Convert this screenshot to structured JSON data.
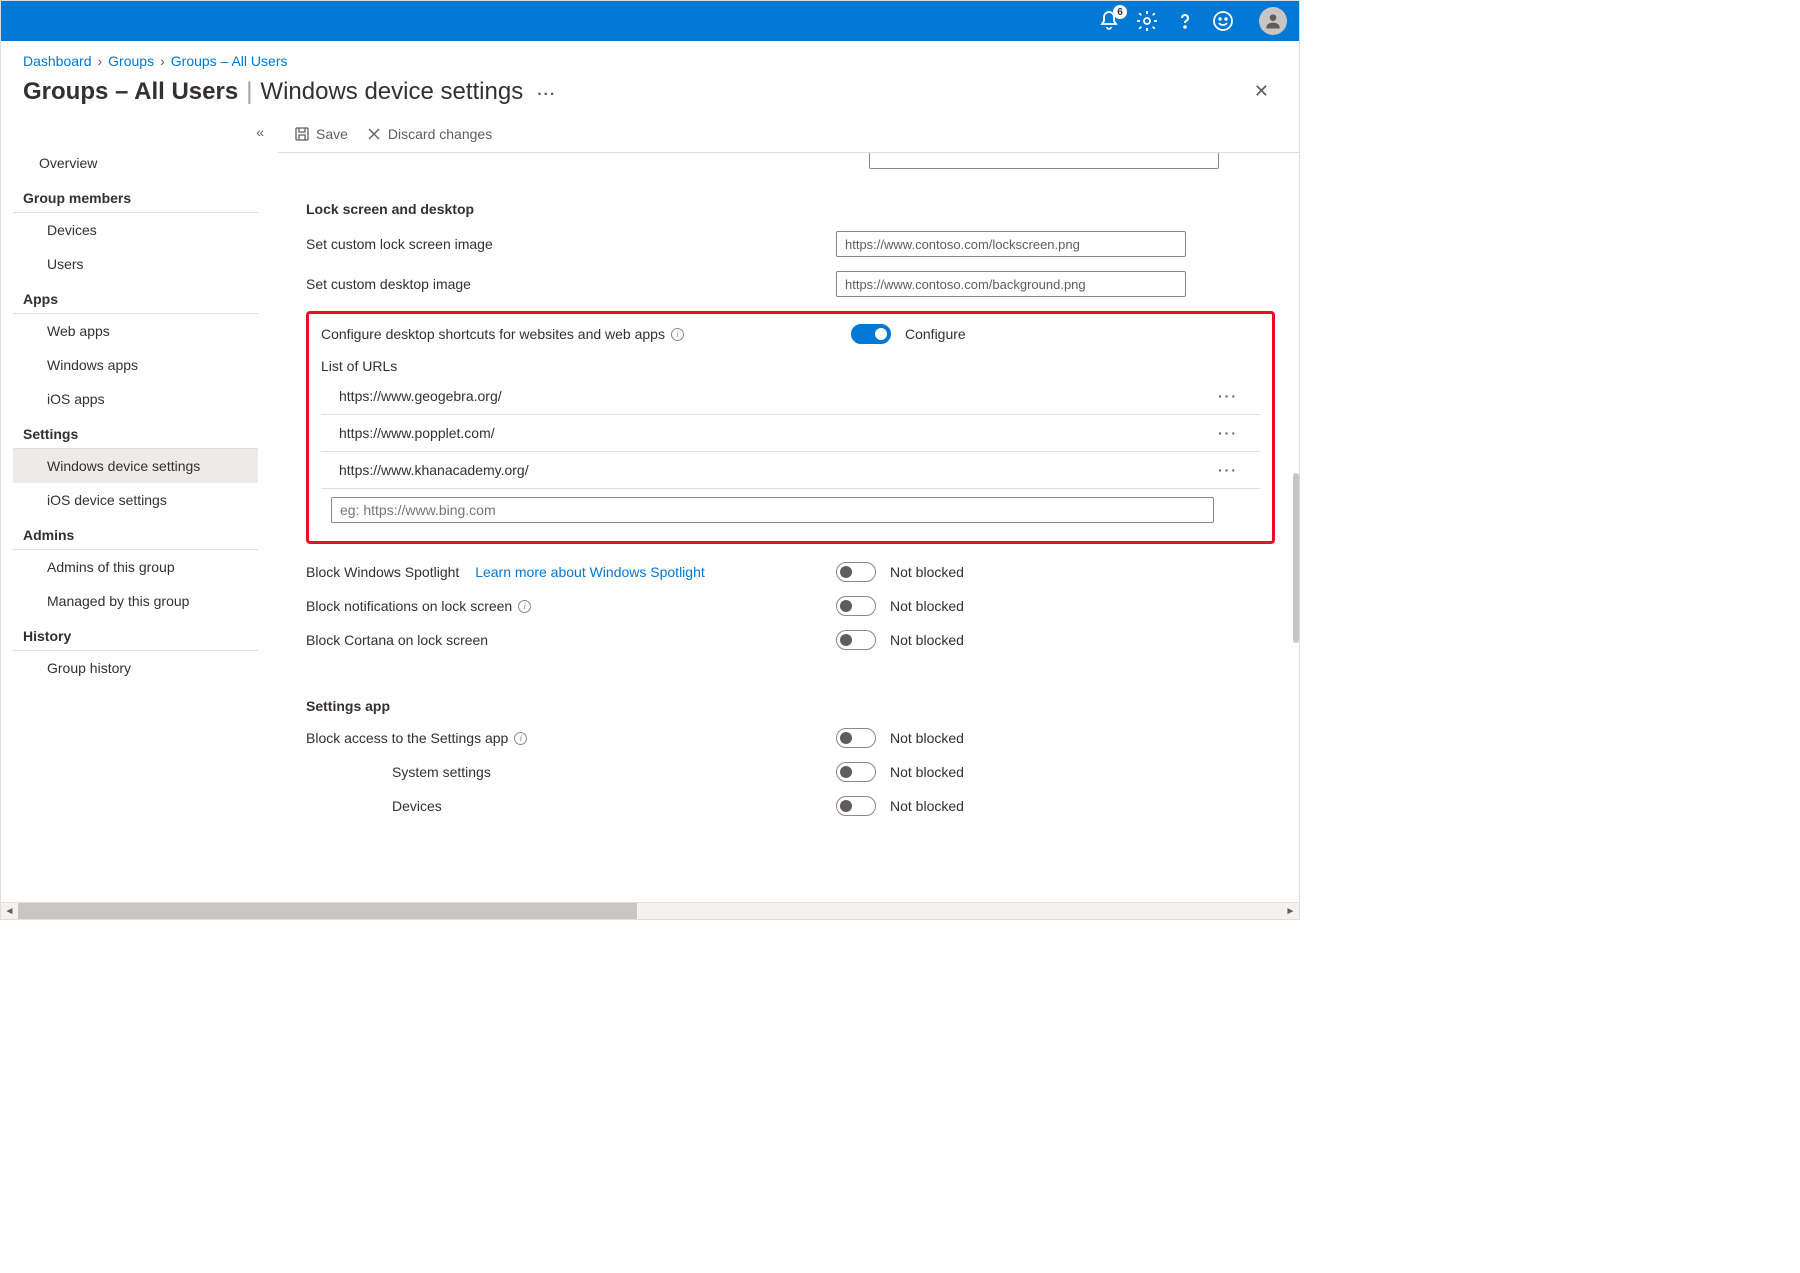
{
  "topbar": {
    "notification_count": "6"
  },
  "breadcrumb": {
    "items": [
      "Dashboard",
      "Groups",
      "Groups – All Users"
    ]
  },
  "title": {
    "group": "Groups – All Users",
    "page": "Windows device settings"
  },
  "toolbar": {
    "save": "Save",
    "discard": "Discard changes"
  },
  "sidebar": {
    "overview": "Overview",
    "section_members": "Group members",
    "devices": "Devices",
    "users": "Users",
    "section_apps": "Apps",
    "web_apps": "Web apps",
    "windows_apps": "Windows apps",
    "ios_apps": "iOS apps",
    "section_settings": "Settings",
    "windows_settings": "Windows device settings",
    "ios_settings": "iOS device settings",
    "section_admins": "Admins",
    "admins_of": "Admins of this group",
    "managed_by": "Managed by this group",
    "section_history": "History",
    "group_history": "Group history"
  },
  "main": {
    "section_lock": "Lock screen and desktop",
    "set_lock": "Set custom lock screen image",
    "set_lock_val": "https://www.contoso.com/lockscreen.png",
    "set_desktop": "Set custom desktop image",
    "set_desktop_val": "https://www.contoso.com/background.png",
    "configure_shortcuts": "Configure desktop shortcuts for websites and web apps",
    "configure_label": "Configure",
    "list_urls": "List of URLs",
    "urls": [
      "https://www.geogebra.org/",
      "https://www.popplet.com/",
      "https://www.khanacademy.org/"
    ],
    "url_placeholder": "eg: https://www.bing.com",
    "block_spotlight": "Block Windows Spotlight",
    "spotlight_link": "Learn more about Windows Spotlight",
    "block_notif": "Block notifications on lock screen",
    "block_cortana": "Block Cortana on lock screen",
    "not_blocked": "Not blocked",
    "section_settings_app": "Settings app",
    "block_settings_app": "Block access to the Settings app",
    "system_settings": "System settings",
    "devices_row": "Devices"
  }
}
